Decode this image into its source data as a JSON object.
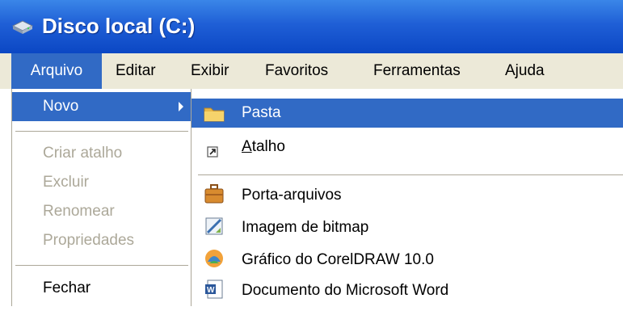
{
  "window": {
    "title": "Disco local (C:)",
    "icon": "drive-icon"
  },
  "menubar": {
    "items": [
      {
        "label": "Arquivo",
        "active": true
      },
      {
        "label": "Editar"
      },
      {
        "label": "Exibir"
      },
      {
        "label": "Favoritos"
      },
      {
        "label": "Ferramentas"
      },
      {
        "label": "Ajuda"
      }
    ]
  },
  "file_menu": {
    "items": [
      {
        "label": "Novo",
        "highlighted": true,
        "has_submenu": true
      },
      {
        "label": "Criar atalho",
        "disabled": true
      },
      {
        "label": "Excluir",
        "disabled": true
      },
      {
        "label": "Renomear",
        "disabled": true
      },
      {
        "label": "Propriedades",
        "disabled": true
      },
      {
        "label": "Fechar"
      }
    ]
  },
  "new_submenu": {
    "items": [
      {
        "label": "Pasta",
        "icon": "folder-icon",
        "highlighted": true
      },
      {
        "label_first": "A",
        "label_rest": "talho",
        "icon": "shortcut-icon"
      },
      {
        "label": "Porta-arquivos",
        "icon": "briefcase-icon"
      },
      {
        "label": "Imagem de bitmap",
        "icon": "bitmap-icon"
      },
      {
        "label": "Gráfico do CorelDRAW 10.0",
        "icon": "coreldraw-icon"
      },
      {
        "label": "Documento do Microsoft Word",
        "icon": "word-document-icon"
      }
    ]
  },
  "colors": {
    "titlebar": "#0b47c4",
    "highlight": "#316ac5",
    "menubar_bg": "#ece9d8",
    "disabled_text": "#aca899"
  }
}
